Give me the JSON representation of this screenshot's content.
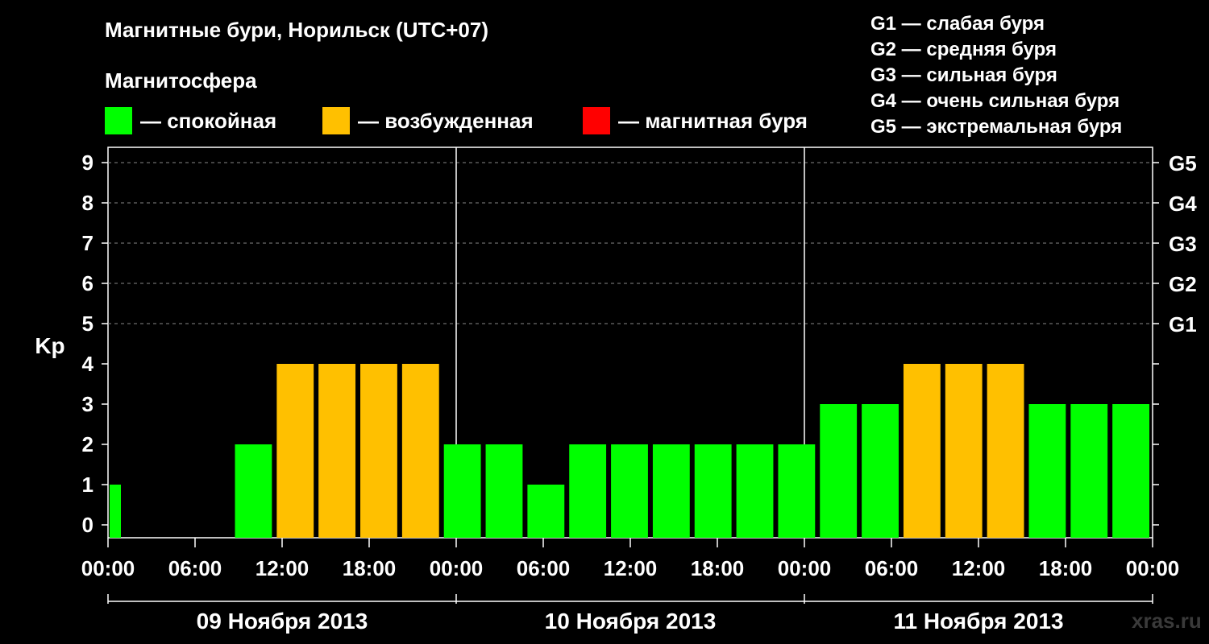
{
  "header": {
    "title": "Магнитные бури, Норильск (UTC+07)",
    "subtitle": "Магнитосфера"
  },
  "legend": {
    "items": [
      {
        "label": "— спокойная",
        "color": "#00ff00"
      },
      {
        "label": "— возбужденная",
        "color": "#ffc000"
      },
      {
        "label": "— магнитная буря",
        "color": "#ff0000"
      }
    ]
  },
  "g_legend": [
    "G1 — слабая буря",
    "G2 — средняя буря",
    "G3 — сильная буря",
    "G4 — очень сильная буря",
    "G5 — экстремальная буря"
  ],
  "watermark": "xras.ru",
  "chart_data": {
    "type": "bar",
    "ylabel": "Kp",
    "ylim": [
      0,
      9
    ],
    "y_ticks": [
      "0",
      "1",
      "2",
      "3",
      "4",
      "5",
      "6",
      "7",
      "8",
      "9"
    ],
    "right_ticks": [
      {
        "value": 5,
        "label": "G1"
      },
      {
        "value": 6,
        "label": "G2"
      },
      {
        "value": 7,
        "label": "G3"
      },
      {
        "value": 8,
        "label": "G4"
      },
      {
        "value": 9,
        "label": "G5"
      }
    ],
    "x_ticks": [
      "00:00",
      "06:00",
      "12:00",
      "18:00",
      "00:00",
      "06:00",
      "12:00",
      "18:00",
      "00:00",
      "06:00",
      "12:00",
      "18:00",
      "00:00"
    ],
    "days": [
      "09 Ноября 2013",
      "10 Ноября 2013",
      "11 Ноября 2013"
    ],
    "interval_hours": 3,
    "values": [
      1,
      0,
      0,
      2,
      4,
      4,
      4,
      4,
      2,
      2,
      1,
      2,
      2,
      2,
      2,
      2,
      2,
      3,
      3,
      4,
      4,
      4,
      3,
      3,
      3
    ],
    "colors": {
      "calm": "#00ff00",
      "excited": "#ffc000",
      "storm": "#ff0000"
    },
    "grid": "dashed horizontal at integer Kp ≥ 5"
  }
}
